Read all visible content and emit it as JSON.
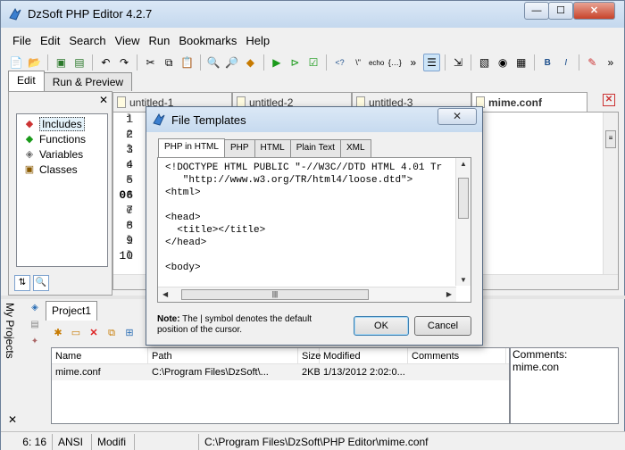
{
  "window": {
    "title": "DzSoft PHP Editor 4.2.7",
    "min": "—",
    "max": "☐",
    "close": "✕"
  },
  "menu": [
    "File",
    "Edit",
    "Search",
    "View",
    "Run",
    "Bookmarks",
    "Help"
  ],
  "mode_tabs": [
    "Edit",
    "Run & Preview"
  ],
  "left_pane": {
    "close": "✕",
    "tree": [
      {
        "label": "Includes",
        "icon": "includes-icon",
        "glyph": "◆"
      },
      {
        "label": "Functions",
        "icon": "functions-icon",
        "glyph": "◆"
      },
      {
        "label": "Variables",
        "icon": "variables-icon",
        "glyph": "◈"
      },
      {
        "label": "Classes",
        "icon": "classes-icon",
        "glyph": "▣"
      }
    ]
  },
  "doc_tabs": [
    "untitled-1",
    "untitled-2",
    "untitled-3",
    "mime.conf"
  ],
  "doc_close": "✕",
  "gutter": [
    "1",
    "2",
    "3",
    "4",
    "5",
    "06",
    "7",
    "8",
    "9",
    "10"
  ],
  "gutter_fragments": [
    "l",
    "e",
    "l",
    "e",
    "e",
    "e",
    "e",
    "e",
    "l",
    "l"
  ],
  "dialog": {
    "title": "File Templates",
    "close": "✕",
    "tabs": [
      "PHP in HTML",
      "PHP",
      "HTML",
      "Plain Text",
      "XML"
    ],
    "code": "<!DOCTYPE HTML PUBLIC \"-//W3C//DTD HTML 4.01 Tr\n   \"http://www.w3.org/TR/html4/loose.dtd\">\n<html>\n\n<head>\n  <title></title>\n</head>\n\n<body>",
    "note_bold": "Note:",
    "note_rest": " The | symbol denotes the default position of the cursor.",
    "ok": "OK",
    "cancel": "Cancel"
  },
  "side_panel": {
    "label": "My Projects",
    "close": "✕"
  },
  "project": {
    "tab": "Project1",
    "columns": [
      "Name",
      "Path",
      "Size",
      "Modified",
      "Comments"
    ],
    "rows": [
      {
        "name": "mime.conf",
        "path": "C:\\Program Files\\DzSoft\\...",
        "size": "2KB",
        "modified": "1/13/2012 2:02:0...",
        "comments": ""
      }
    ],
    "comments_panel": "Comments: mime.con"
  },
  "status": {
    "pos": "6: 16",
    "enc": "ANSI",
    "mod": "Modifi",
    "path": "C:\\Program Files\\DzSoft\\PHP Editor\\mime.conf"
  },
  "colors": {
    "title_bg": "#c4d8ee",
    "close_red": "#c7432a",
    "accent_blue": "#3c7fb1"
  }
}
